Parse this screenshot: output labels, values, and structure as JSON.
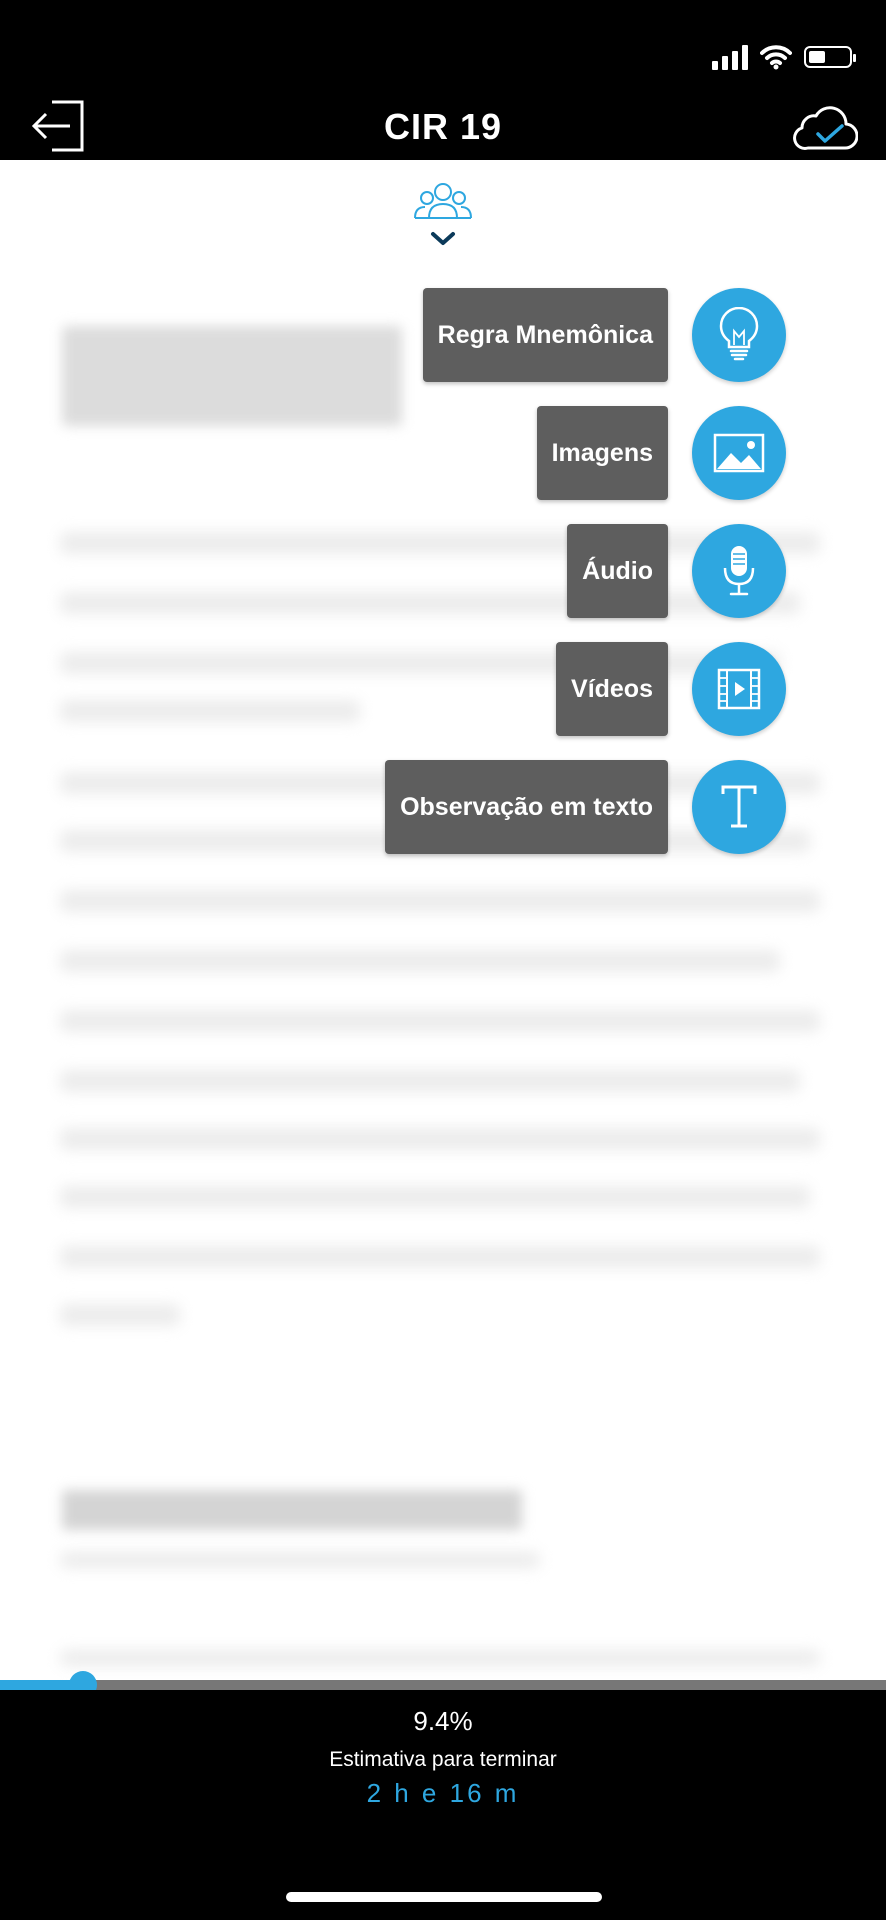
{
  "header": {
    "title": "CIR 19"
  },
  "menu": {
    "items": [
      {
        "label": "Regra Mnemônica",
        "icon": "lightbulb-icon"
      },
      {
        "label": "Imagens",
        "icon": "image-icon"
      },
      {
        "label": "Áudio",
        "icon": "microphone-icon"
      },
      {
        "label": "Vídeos",
        "icon": "video-film-icon"
      },
      {
        "label": "Observação em texto",
        "icon": "text-t-icon"
      }
    ]
  },
  "progress": {
    "percent_text": "9.4%",
    "fraction": 0.094,
    "estimate_label": "Estimativa para terminar",
    "estimate_value": "2 h e 16 m"
  },
  "colors": {
    "accent": "#2ea7e0",
    "label_bg": "#5e5e5e",
    "bar": "#000000"
  }
}
